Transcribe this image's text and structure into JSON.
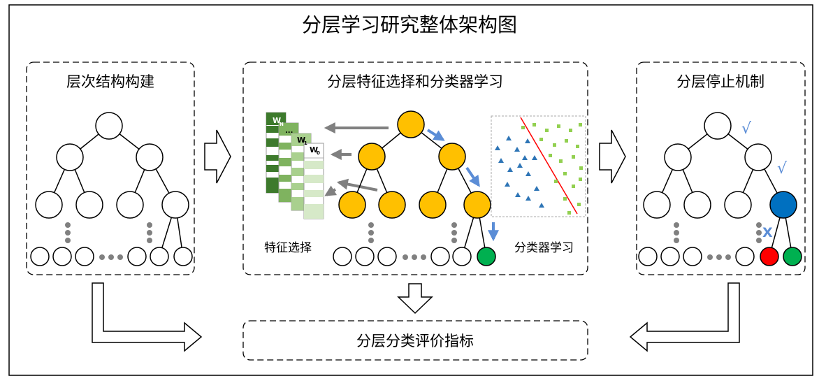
{
  "title": "分层学习研究整体架构图",
  "panels": {
    "left": {
      "title": "层次结构构建"
    },
    "middle": {
      "title": "分层特征选择和分类器学习",
      "feature_label": "特征选择",
      "classifier_label": "分类器学习",
      "weight_labels": [
        "W",
        "...",
        "W",
        "W"
      ],
      "weight_subs": [
        "N",
        "",
        "1",
        "0"
      ]
    },
    "right": {
      "title": "分层停止机制",
      "check_mark": "√",
      "stop_mark": "X"
    },
    "bottom": {
      "title": "分层分类评价指标"
    }
  },
  "colors": {
    "orange_node": "#FFC000",
    "blue_node": "#0070C0",
    "red_node": "#FF0000",
    "green_node": "#00B050",
    "blue_arrow": "#5B8DD6",
    "gray_arrow": "#808080",
    "triangle": "#2E75B6",
    "square": "#92D050",
    "separator": "#FF0000",
    "weight_greens": [
      "#3D7A2C",
      "#7FB35F",
      "#A9D08E",
      "#D6E9C8"
    ]
  },
  "icons": [
    "block-arrow-right-icon",
    "block-arrow-down-icon",
    "l-arrow-icon",
    "gray-arrow-icon",
    "blue-arrow-icon"
  ]
}
